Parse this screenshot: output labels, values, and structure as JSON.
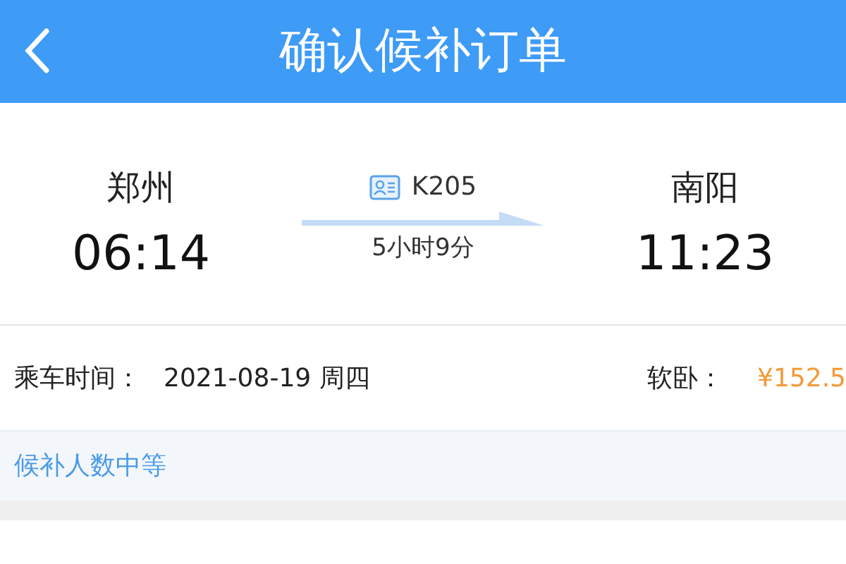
{
  "header": {
    "title": "确认候补订单"
  },
  "trip": {
    "from": {
      "station": "郑州",
      "time": "06:14"
    },
    "train": "K205",
    "duration": "5小时9分",
    "to": {
      "station": "南阳",
      "time": "11:23"
    }
  },
  "ride": {
    "label": "乘车时间：",
    "date": "2021-08-19 周四",
    "seat": "软卧：",
    "price": "¥152.5"
  },
  "notice": "候补人数中等"
}
